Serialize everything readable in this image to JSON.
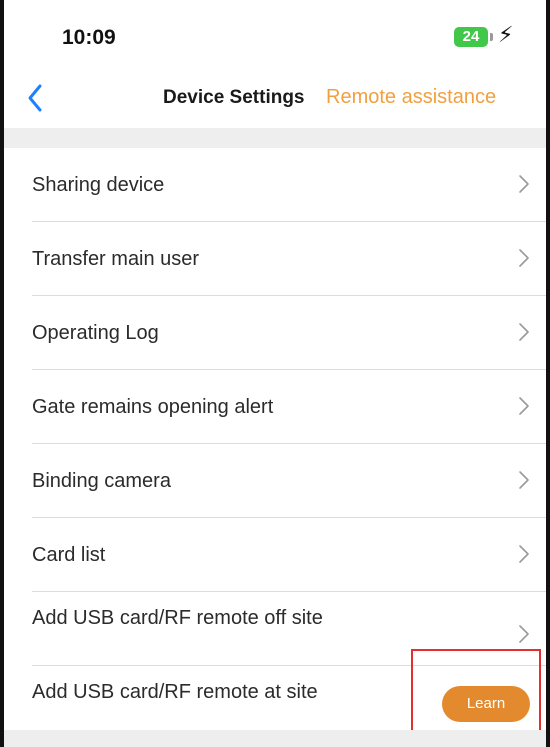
{
  "status_bar": {
    "time": "10:09",
    "battery_level": "24"
  },
  "nav": {
    "title": "Device Settings",
    "action": "Remote assistance",
    "back_icon": "chevron-left-icon"
  },
  "settings": {
    "items": [
      {
        "label": "Sharing device"
      },
      {
        "label": "Transfer main user"
      },
      {
        "label": "Operating Log"
      },
      {
        "label": "Gate remains opening alert"
      },
      {
        "label": "Binding camera"
      },
      {
        "label": "Card list"
      },
      {
        "label": "Add USB card/RF remote off site"
      },
      {
        "label": "Add USB card/RF remote at site",
        "button_label": "Learn"
      }
    ]
  },
  "colors": {
    "accent": "#f0a040",
    "learn_button": "#e38a2e",
    "back_icon": "#1e80ff",
    "battery": "#41c84a",
    "highlight": "#e03030"
  }
}
